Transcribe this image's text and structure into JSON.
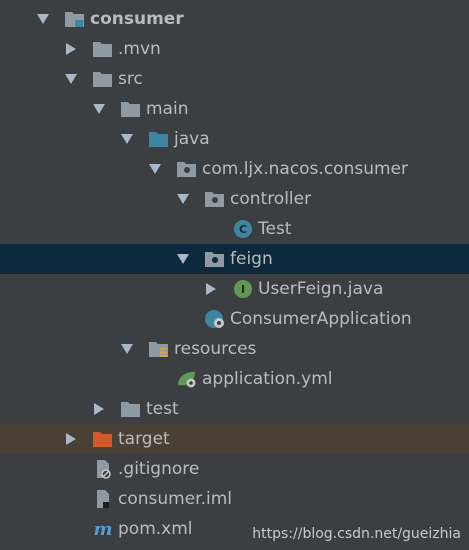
{
  "tree": {
    "root": "consumer",
    "mvn": ".mvn",
    "src": "src",
    "main": "main",
    "java": "java",
    "package": "com.ljx.nacos.consumer",
    "controller": "controller",
    "test_class": "Test",
    "feign": "feign",
    "userfeign": "UserFeign.java",
    "consumer_app": "ConsumerApplication",
    "resources": "resources",
    "app_yml": "application.yml",
    "test_dir": "test",
    "target": "target",
    "gitignore": ".gitignore",
    "iml": "consumer.iml",
    "pom": "pom.xml"
  },
  "watermark": "https://blog.csdn.net/gueizhia",
  "colors": {
    "background": "#3c3f41",
    "selected": "#0d293e",
    "excluded": "#4a4036",
    "folder": "#8f9aa3",
    "source_folder": "#3e86a0",
    "excluded_folder": "#d05a2a"
  }
}
